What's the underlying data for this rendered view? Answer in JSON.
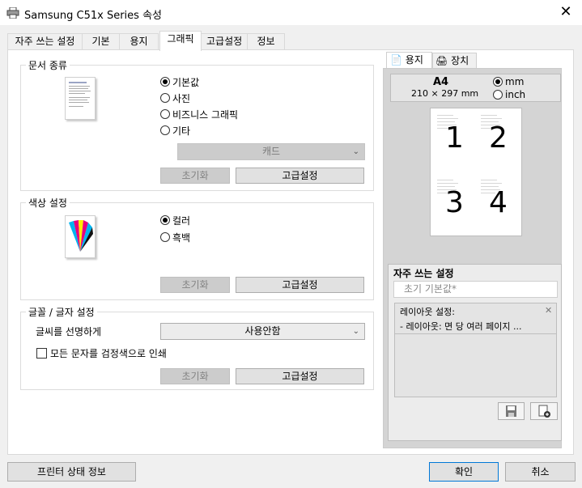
{
  "window": {
    "title": "Samsung C51x Series 속성",
    "close_symbol": "✕"
  },
  "tabs": [
    {
      "label": "자주 쓰는 설정"
    },
    {
      "label": "기본"
    },
    {
      "label": "용지"
    },
    {
      "label": "그래픽"
    },
    {
      "label": "고급설정"
    },
    {
      "label": "정보"
    }
  ],
  "document_type": {
    "title": "문서 종류",
    "options": [
      "기본값",
      "사진",
      "비즈니스 그래픽",
      "기타"
    ],
    "selected_index": 0,
    "dropdown_value": "캐드",
    "reset_label": "초기화",
    "advanced_label": "고급설정"
  },
  "color_settings": {
    "title": "색상 설정",
    "options": [
      "컬러",
      "흑백"
    ],
    "selected_index": 0,
    "reset_label": "초기화",
    "advanced_label": "고급설정"
  },
  "font_settings": {
    "title": "글꼴 / 글자 설정",
    "sharpen_label": "글씨를 선명하게",
    "sharpen_value": "사용안함",
    "black_text_label": "모든 문자를 검정색으로 인쇄",
    "black_text_checked": false,
    "reset_label": "초기화",
    "advanced_label": "고급설정"
  },
  "preview_panel": {
    "tabs": [
      "용지",
      "장치"
    ],
    "paper_name": "A4",
    "paper_size": "210 × 297 mm",
    "units": [
      "mm",
      "inch"
    ],
    "unit_selected_index": 0,
    "page_numbers": [
      "1",
      "2",
      "3",
      "4"
    ]
  },
  "favorites": {
    "title": "자주 쓰는 설정",
    "input_value": "초기 기본값*",
    "detail_title": "레이아웃 설정:",
    "detail_line": "- 레이아웃: 면 당 여러 페이지 ...",
    "delete_symbol": "✕"
  },
  "footer": {
    "printer_status_label": "프린터 상태 정보",
    "ok_label": "확인",
    "cancel_label": "취소"
  },
  "colors": {
    "primary_button_border": "#0078d7",
    "window_bg": "#f0f0f0",
    "panel_bg": "#d4d4d4"
  }
}
